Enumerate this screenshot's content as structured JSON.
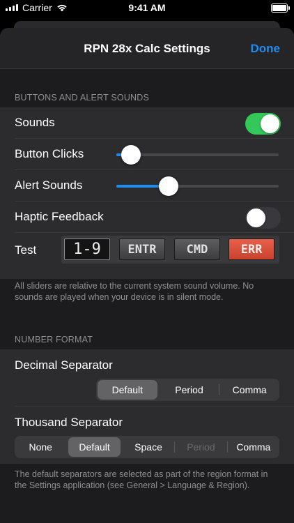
{
  "status": {
    "carrier": "Carrier",
    "time": "9:41 AM"
  },
  "nav": {
    "title": "RPN 28x Calc Settings",
    "done": "Done"
  },
  "buttons_section": {
    "header": "BUTTONS AND ALERT SOUNDS",
    "sounds": {
      "label": "Sounds",
      "on": true
    },
    "button_clicks": {
      "label": "Button Clicks",
      "level": 0.09
    },
    "alert_sounds": {
      "label": "Alert Sounds",
      "level": 0.32
    },
    "haptic": {
      "label": "Haptic Feedback",
      "on": false
    },
    "test": {
      "label": "Test",
      "keys": [
        "1-9",
        "ENTR",
        "CMD",
        "ERR"
      ]
    },
    "footer": "All sliders are relative to the current system sound volume. No sounds are played when your device is in silent mode."
  },
  "number_section": {
    "header": "NUMBER FORMAT",
    "decimal": {
      "label": "Decimal Separator",
      "options": [
        "Default",
        "Period",
        "Comma"
      ],
      "selected": "Default"
    },
    "thousand": {
      "label": "Thousand Separator",
      "options": [
        "None",
        "Default",
        "Space",
        "Period",
        "Comma"
      ],
      "selected": "Default",
      "disabled": "Period"
    },
    "footer": "The default separators are selected as part of the region format in the Settings application (see General > Language & Region)."
  },
  "colors": {
    "accent": "#1e8cf0",
    "toggle_on": "#34c759",
    "err_key": "#d9533d"
  }
}
